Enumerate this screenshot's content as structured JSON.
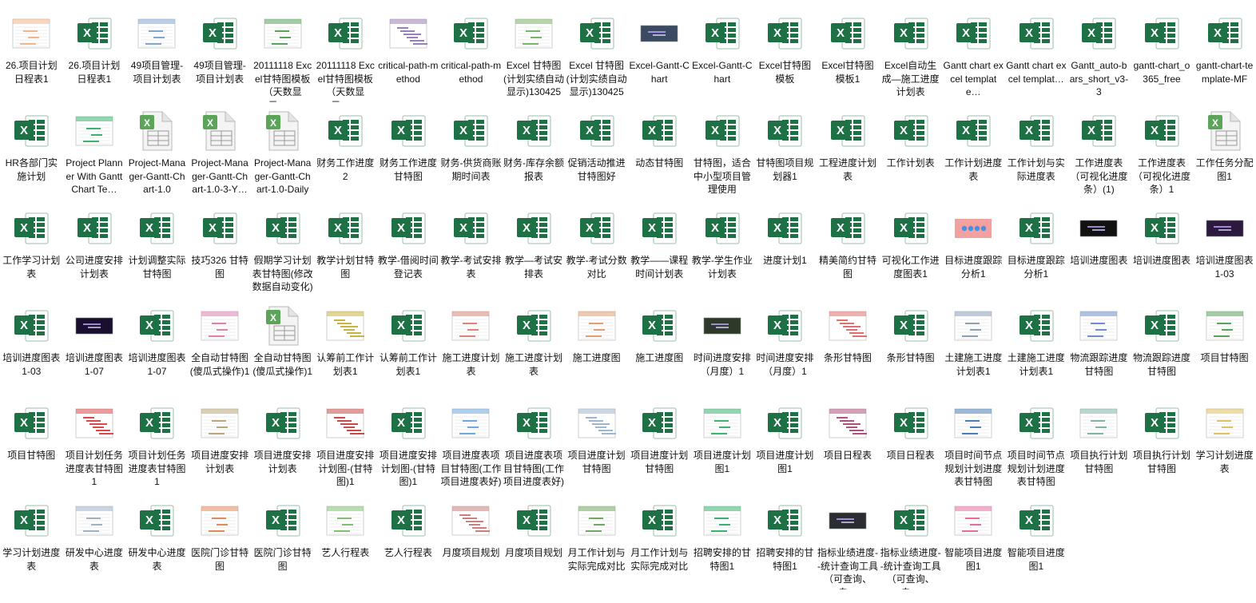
{
  "files": [
    {
      "label": "26.项目计划日程表1",
      "icon": "chart-preview-icon",
      "kind": "preview",
      "accent": "#f2b48b"
    },
    {
      "label": "26.项目计划日程表1",
      "icon": "excel-icon",
      "kind": "excel"
    },
    {
      "label": "49项目管理-项目计划表",
      "icon": "table-preview-icon",
      "kind": "preview",
      "accent": "#7da7cf"
    },
    {
      "label": "49项目管理-项目计划表",
      "icon": "excel-icon",
      "kind": "excel"
    },
    {
      "label": "20111118 Excel甘特图模板（天数显示，…",
      "icon": "table-preview-icon",
      "kind": "preview",
      "accent": "#5aa35a"
    },
    {
      "label": "20111118 Excel甘特图模板（天数显示，…",
      "icon": "excel-icon",
      "kind": "excel"
    },
    {
      "label": "critical-path-method",
      "icon": "gantt-preview-icon",
      "kind": "preview",
      "accent": "#9b7fb8"
    },
    {
      "label": "critical-path-method",
      "icon": "excel-icon",
      "kind": "excel"
    },
    {
      "label": "Excel 甘特图(计划实绩自动显示)130425",
      "icon": "table-preview-icon",
      "kind": "preview",
      "accent": "#7ab36a"
    },
    {
      "label": "Excel 甘特图(计划实绩自动显示)130425",
      "icon": "excel-icon",
      "kind": "excel"
    },
    {
      "label": "Excel-Gantt-Chart",
      "icon": "dark-chart-preview-icon",
      "kind": "dark",
      "accent": "#3b4a63"
    },
    {
      "label": "Excel-Gantt-Chart",
      "icon": "excel-icon",
      "kind": "excel"
    },
    {
      "label": "Excel甘特图模板",
      "icon": "excel-icon",
      "kind": "excel"
    },
    {
      "label": "Excel甘特图模板1",
      "icon": "excel-icon",
      "kind": "excel"
    },
    {
      "label": "Excel自动生成—施工进度计划表",
      "icon": "excel-icon",
      "kind": "excel"
    },
    {
      "label": "Gantt chart excel template…",
      "icon": "excel-icon",
      "kind": "excel"
    },
    {
      "label": "Gantt chart excel templat…",
      "icon": "excel-icon",
      "kind": "excel"
    },
    {
      "label": "Gantt_auto-bars_short_v3-3",
      "icon": "excel-icon",
      "kind": "excel"
    },
    {
      "label": "gantt-chart_o365_free",
      "icon": "excel-icon",
      "kind": "excel"
    },
    {
      "label": "gantt-chart-template-MF",
      "icon": "excel-icon",
      "kind": "excel"
    },
    {
      "label": "HR各部门实施计划",
      "icon": "excel-icon",
      "kind": "excel"
    },
    {
      "label": "Project Planner With Gantt Chart Te…",
      "icon": "table-preview-icon",
      "kind": "preview",
      "accent": "#3cb371"
    },
    {
      "label": "Project-Manager-Gantt-Chart-1.0",
      "icon": "excel-file-icon",
      "kind": "file"
    },
    {
      "label": "Project-Manager-Gantt-Chart-1.0-3-Y…",
      "icon": "excel-file-icon",
      "kind": "file"
    },
    {
      "label": "Project-Manager-Gantt-Chart-1.0-Daily",
      "icon": "excel-file-icon",
      "kind": "file"
    },
    {
      "label": "财务工作进度2",
      "icon": "excel-icon",
      "kind": "excel"
    },
    {
      "label": "财务工作进度甘特图",
      "icon": "excel-icon",
      "kind": "excel"
    },
    {
      "label": "财务-供货商账期时间表",
      "icon": "excel-icon",
      "kind": "excel"
    },
    {
      "label": "财务-库存余额报表",
      "icon": "excel-icon",
      "kind": "excel"
    },
    {
      "label": "促销活动推进甘特图好",
      "icon": "excel-icon",
      "kind": "excel"
    },
    {
      "label": "动态甘特图",
      "icon": "excel-icon",
      "kind": "excel"
    },
    {
      "label": "甘特图，适合中小型项目管理使用",
      "icon": "excel-icon",
      "kind": "excel"
    },
    {
      "label": "甘特图项目规划器1",
      "icon": "excel-icon",
      "kind": "excel"
    },
    {
      "label": "工程进度计划表",
      "icon": "excel-icon",
      "kind": "excel"
    },
    {
      "label": "工作计划表",
      "icon": "excel-icon",
      "kind": "excel"
    },
    {
      "label": "工作计划进度表",
      "icon": "excel-icon",
      "kind": "excel"
    },
    {
      "label": "工作计划与实际进度表",
      "icon": "excel-icon",
      "kind": "excel"
    },
    {
      "label": "工作进度表（可视化进度条）(1)",
      "icon": "excel-icon",
      "kind": "excel"
    },
    {
      "label": "工作进度表（可视化进度条）1",
      "icon": "excel-icon",
      "kind": "excel"
    },
    {
      "label": "工作任务分配图1",
      "icon": "excel-file-icon",
      "kind": "file"
    },
    {
      "label": "工作学习计划表",
      "icon": "excel-icon",
      "kind": "excel"
    },
    {
      "label": "公司进度安排计划表",
      "icon": "excel-icon",
      "kind": "excel"
    },
    {
      "label": "计划调整实际甘特图",
      "icon": "excel-icon",
      "kind": "excel"
    },
    {
      "label": "技巧326 甘特图",
      "icon": "excel-icon",
      "kind": "excel"
    },
    {
      "label": "假期学习计划表甘特图(修改数据自动变化)",
      "icon": "excel-icon",
      "kind": "excel"
    },
    {
      "label": "教学计划甘特图",
      "icon": "excel-icon",
      "kind": "excel"
    },
    {
      "label": "教学-借阅时间登记表",
      "icon": "excel-icon",
      "kind": "excel"
    },
    {
      "label": "教学-考试安排表",
      "icon": "excel-icon",
      "kind": "excel"
    },
    {
      "label": "教学—考试安排表",
      "icon": "excel-icon",
      "kind": "excel"
    },
    {
      "label": "教学-考试分数对比",
      "icon": "excel-icon",
      "kind": "excel"
    },
    {
      "label": "教学——课程时间计划表",
      "icon": "excel-icon",
      "kind": "excel"
    },
    {
      "label": "教学-学生作业计划表",
      "icon": "excel-icon",
      "kind": "excel"
    },
    {
      "label": "进度计划1",
      "icon": "excel-icon",
      "kind": "excel"
    },
    {
      "label": "精美简约甘特图",
      "icon": "excel-icon",
      "kind": "excel"
    },
    {
      "label": "可视化工作进度图表1",
      "icon": "excel-icon",
      "kind": "excel"
    },
    {
      "label": "目标进度跟踪分析1",
      "icon": "pink-dots-preview-icon",
      "kind": "pink"
    },
    {
      "label": "目标进度跟踪分析1",
      "icon": "excel-icon",
      "kind": "excel"
    },
    {
      "label": "培训进度图表",
      "icon": "dark-chart-preview-icon",
      "kind": "dark",
      "accent": "#111111"
    },
    {
      "label": "培训进度图表",
      "icon": "excel-icon",
      "kind": "excel"
    },
    {
      "label": "培训进度图表1-03",
      "icon": "dark-chart-preview-icon",
      "kind": "dark",
      "accent": "#2b1a3d"
    },
    {
      "label": "培训进度图表1-03",
      "icon": "excel-icon",
      "kind": "excel"
    },
    {
      "label": "培训进度图表1-07",
      "icon": "dark-chart-preview-icon",
      "kind": "dark",
      "accent": "#1a0f2e"
    },
    {
      "label": "培训进度图表1-07",
      "icon": "excel-icon",
      "kind": "excel"
    },
    {
      "label": "全自动甘特图(傻瓜式操作)1",
      "icon": "table-preview-icon",
      "kind": "preview",
      "accent": "#e07fb0"
    },
    {
      "label": "全自动甘特图(傻瓜式操作)1",
      "icon": "excel-file-icon",
      "kind": "file"
    },
    {
      "label": "认筹前工作计划表1",
      "icon": "gantt-preview-icon",
      "kind": "preview",
      "accent": "#c9b440"
    },
    {
      "label": "认筹前工作计划表1",
      "icon": "excel-icon",
      "kind": "excel"
    },
    {
      "label": "施工进度计划表",
      "icon": "table-preview-icon",
      "kind": "preview",
      "accent": "#d9857a"
    },
    {
      "label": "施工进度计划表",
      "icon": "excel-icon",
      "kind": "excel"
    },
    {
      "label": "施工进度图",
      "icon": "table-preview-icon",
      "kind": "preview",
      "accent": "#e0a070"
    },
    {
      "label": "施工进度图",
      "icon": "excel-icon",
      "kind": "excel"
    },
    {
      "label": "时间进度安排（月度）1",
      "icon": "dark-chart-preview-icon",
      "kind": "dark",
      "accent": "#2d3a2a"
    },
    {
      "label": "时间进度安排（月度）1",
      "icon": "excel-icon",
      "kind": "excel"
    },
    {
      "label": "条形甘特图",
      "icon": "gantt-preview-icon",
      "kind": "preview",
      "accent": "#e07070"
    },
    {
      "label": "条形甘特图",
      "icon": "excel-icon",
      "kind": "excel"
    },
    {
      "label": "土建施工进度计划表1",
      "icon": "table-preview-icon",
      "kind": "preview",
      "accent": "#8aa0b8"
    },
    {
      "label": "土建施工进度计划表1",
      "icon": "excel-icon",
      "kind": "excel"
    },
    {
      "label": "物流跟踪进度甘特图",
      "icon": "table-preview-icon",
      "kind": "preview",
      "accent": "#6f8fc9"
    },
    {
      "label": "物流跟踪进度甘特图",
      "icon": "excel-icon",
      "kind": "excel"
    },
    {
      "label": "项目甘特图",
      "icon": "table-preview-icon",
      "kind": "preview",
      "accent": "#5aa35a"
    },
    {
      "label": "项目甘特图",
      "icon": "excel-icon",
      "kind": "excel"
    },
    {
      "label": "项目计划任务进度表甘特图1",
      "icon": "gantt-preview-icon",
      "kind": "preview",
      "accent": "#d94a4a"
    },
    {
      "label": "项目计划任务进度表甘特图1",
      "icon": "excel-icon",
      "kind": "excel"
    },
    {
      "label": "项目进度安排计划表",
      "icon": "table-preview-icon",
      "kind": "preview",
      "accent": "#b9a67a"
    },
    {
      "label": "项目进度安排计划表",
      "icon": "excel-icon",
      "kind": "excel"
    },
    {
      "label": "项目进度安排计划图-(甘特图)1",
      "icon": "gantt-preview-icon",
      "kind": "preview",
      "accent": "#c94a4a"
    },
    {
      "label": "项目进度安排计划图-(甘特图)1",
      "icon": "excel-icon",
      "kind": "excel"
    },
    {
      "label": "项目进度表项目甘特图(工作项目进度表好)",
      "icon": "table-preview-icon",
      "kind": "preview",
      "accent": "#6fa8dc"
    },
    {
      "label": "项目进度表项目甘特图(工作项目进度表好)",
      "icon": "excel-icon",
      "kind": "excel"
    },
    {
      "label": "项目进度计划甘特图",
      "icon": "gantt-preview-icon",
      "kind": "preview",
      "accent": "#9fb7cf"
    },
    {
      "label": "项目进度计划甘特图",
      "icon": "excel-icon",
      "kind": "excel"
    },
    {
      "label": "项目进度计划图1",
      "icon": "table-preview-icon",
      "kind": "preview",
      "accent": "#3cb371"
    },
    {
      "label": "项目进度计划图1",
      "icon": "excel-icon",
      "kind": "excel"
    },
    {
      "label": "项目日程表",
      "icon": "gantt-preview-icon",
      "kind": "preview",
      "accent": "#b05080"
    },
    {
      "label": "项目日程表",
      "icon": "excel-icon",
      "kind": "excel"
    },
    {
      "label": "项目时间节点规划计划进度表甘特图",
      "icon": "table-preview-icon",
      "kind": "preview",
      "accent": "#4a7fb8"
    },
    {
      "label": "项目时间节点规划计划进度表甘特图",
      "icon": "excel-icon",
      "kind": "excel"
    },
    {
      "label": "项目执行计划甘特图",
      "icon": "table-preview-icon",
      "kind": "preview",
      "accent": "#7fb3a8"
    },
    {
      "label": "项目执行计划甘特图",
      "icon": "excel-icon",
      "kind": "excel"
    },
    {
      "label": "学习计划进度表",
      "icon": "table-preview-icon",
      "kind": "preview",
      "accent": "#e0c060"
    },
    {
      "label": "学习计划进度表",
      "icon": "excel-icon",
      "kind": "excel"
    },
    {
      "label": "研发中心进度表",
      "icon": "table-preview-icon",
      "kind": "preview",
      "accent": "#a0b0c8"
    },
    {
      "label": "研发中心进度表",
      "icon": "excel-icon",
      "kind": "excel"
    },
    {
      "label": "医院门诊甘特图",
      "icon": "table-preview-icon",
      "kind": "preview",
      "accent": "#e08a5a"
    },
    {
      "label": "医院门诊甘特图",
      "icon": "excel-icon",
      "kind": "excel"
    },
    {
      "label": "艺人行程表",
      "icon": "table-preview-icon",
      "kind": "preview",
      "accent": "#7fbf6f"
    },
    {
      "label": "艺人行程表",
      "icon": "excel-icon",
      "kind": "excel"
    },
    {
      "label": "月度项目规划",
      "icon": "gantt-preview-icon",
      "kind": "preview",
      "accent": "#c98080"
    },
    {
      "label": "月度项目规划",
      "icon": "excel-icon",
      "kind": "excel"
    },
    {
      "label": "月工作计划与实际完成对比",
      "icon": "table-preview-icon",
      "kind": "preview",
      "accent": "#6fa860"
    },
    {
      "label": "月工作计划与实际完成对比",
      "icon": "excel-icon",
      "kind": "excel"
    },
    {
      "label": "招聘安排的甘特图1",
      "icon": "table-preview-icon",
      "kind": "preview",
      "accent": "#3cb371"
    },
    {
      "label": "招聘安排的甘特图1",
      "icon": "excel-icon",
      "kind": "excel"
    },
    {
      "label": "指标业绩进度--统计查询工具（可查询、自…",
      "icon": "dark-chart-preview-icon",
      "kind": "dark",
      "accent": "#2a2e33"
    },
    {
      "label": "指标业绩进度--统计查询工具（可查询、自…",
      "icon": "excel-icon",
      "kind": "excel"
    },
    {
      "label": "智能项目进度图1",
      "icon": "table-preview-icon",
      "kind": "preview",
      "accent": "#e070a0"
    },
    {
      "label": "智能项目进度图1",
      "icon": "excel-icon",
      "kind": "excel"
    }
  ],
  "colors": {
    "excel_green": "#1e7145",
    "excel_green_light": "#21a366",
    "text": "#111111"
  }
}
